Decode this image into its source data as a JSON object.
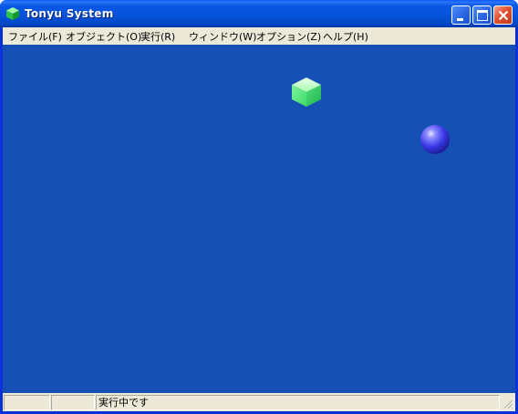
{
  "window": {
    "title": "Tonyu System",
    "app_icon": "green-cube-icon",
    "controls": {
      "minimize": "minimize-icon",
      "maximize": "maximize-icon",
      "close": "close-icon"
    }
  },
  "menu": {
    "items": [
      {
        "label": "ファイル(F)"
      },
      {
        "label": "オブジェクト(O)"
      },
      {
        "label": "実行(R)"
      },
      {
        "label": "ウィンドウ(W)"
      },
      {
        "label": "オプション(Z)"
      },
      {
        "label": "ヘルプ(H)"
      }
    ]
  },
  "canvas": {
    "background": "#1650b4",
    "sprites": [
      "green-cube-sprite",
      "blue-ball-sprite"
    ]
  },
  "status": {
    "panel1": "",
    "panel2": "",
    "message": "実行中です"
  },
  "colors": {
    "titlebar": "#0552d9",
    "menubar": "#ece9d8",
    "canvas": "#1650b4",
    "close_button": "#e0522f"
  }
}
